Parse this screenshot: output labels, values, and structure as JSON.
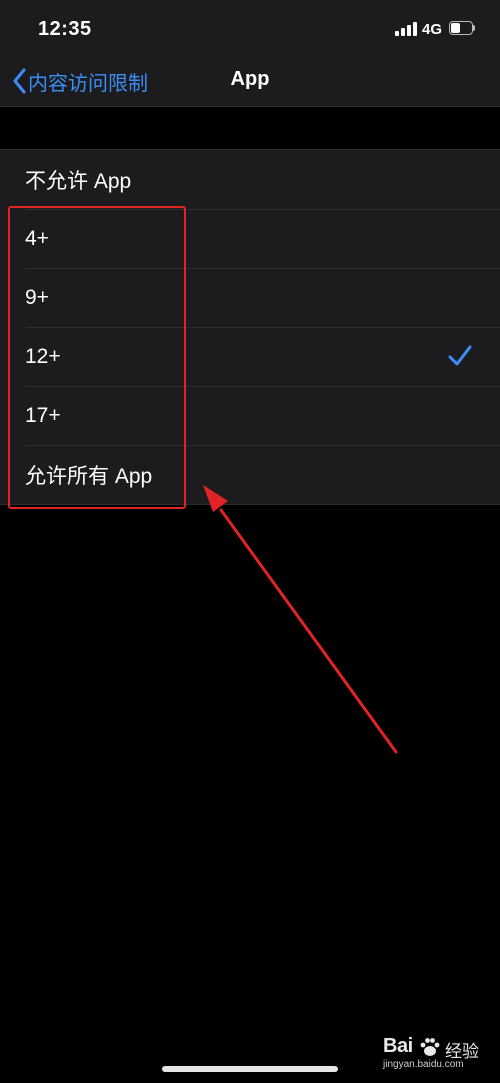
{
  "status_bar": {
    "time": "12:35",
    "network": "4G",
    "battery_level": 0.45
  },
  "nav": {
    "back_label": "内容访问限制",
    "title": "App"
  },
  "settings": {
    "items": [
      {
        "label": "不允许 App",
        "selected": false
      },
      {
        "label": "4+",
        "selected": false
      },
      {
        "label": "9+",
        "selected": false
      },
      {
        "label": "12+",
        "selected": true
      },
      {
        "label": "17+",
        "selected": false
      },
      {
        "label": "允许所有 App",
        "selected": false
      }
    ]
  },
  "colors": {
    "accent": "#3a8ef6",
    "annotation": "#e02424",
    "background": "#000000",
    "cell": "#1c1c1e"
  },
  "watermark": {
    "brand": "Bai",
    "brand_cn": "经验",
    "domain": "jingyan.baidu.com"
  },
  "icons": [
    "chevron-left-icon",
    "checkmark-icon",
    "signal-icon",
    "battery-icon",
    "paw-icon"
  ]
}
